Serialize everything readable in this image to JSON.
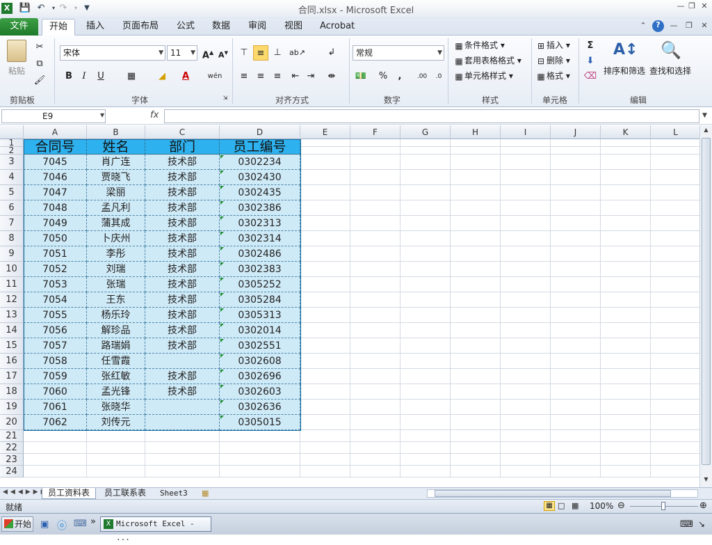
{
  "window": {
    "title": "合同.xlsx - Microsoft Excel"
  },
  "tabs": [
    {
      "label": "文件"
    },
    {
      "label": "开始"
    },
    {
      "label": "插入"
    },
    {
      "label": "页面布局"
    },
    {
      "label": "公式"
    },
    {
      "label": "数据"
    },
    {
      "label": "审阅"
    },
    {
      "label": "视图"
    },
    {
      "label": "Acrobat"
    }
  ],
  "ribbon": {
    "clipboard": {
      "paste": "粘贴",
      "label": "剪贴板"
    },
    "font": {
      "name": "宋体",
      "size": "11",
      "label": "字体"
    },
    "align": {
      "label": "对齐方式"
    },
    "number": {
      "format": "常规",
      "label": "数字"
    },
    "styles": {
      "cond": "条件格式",
      "table": "套用表格格式",
      "cell": "单元格样式",
      "label": "样式"
    },
    "cells": {
      "insert": "插入",
      "delete": "删除",
      "format": "格式",
      "label": "单元格"
    },
    "edit": {
      "sort": "排序和筛选",
      "find": "查找和选择",
      "label": "编辑"
    }
  },
  "namebox": "E9",
  "fx": "fx",
  "columns": [
    "A",
    "B",
    "C",
    "D",
    "E",
    "F",
    "G",
    "H",
    "I",
    "J",
    "K",
    "L"
  ],
  "table": {
    "headers": [
      "合同号",
      "姓名",
      "部门",
      "员工编号"
    ],
    "rows": [
      [
        "7045",
        "肖广连",
        "技术部",
        "0302234"
      ],
      [
        "7046",
        "贾晓飞",
        "技术部",
        "0302430"
      ],
      [
        "7047",
        "梁丽",
        "技术部",
        "0302435"
      ],
      [
        "7048",
        "孟凡利",
        "技术部",
        "0302386"
      ],
      [
        "7049",
        "蒲其成",
        "技术部",
        "0302313"
      ],
      [
        "7050",
        "卜庆州",
        "技术部",
        "0302314"
      ],
      [
        "7051",
        "李彤",
        "技术部",
        "0302486"
      ],
      [
        "7052",
        "刘瑞",
        "技术部",
        "0302383"
      ],
      [
        "7053",
        "张瑞",
        "技术部",
        "0305252"
      ],
      [
        "7054",
        "王东",
        "技术部",
        "0305284"
      ],
      [
        "7055",
        "杨乐玲",
        "技术部",
        "0305313"
      ],
      [
        "7056",
        "解珍品",
        "技术部",
        "0302014"
      ],
      [
        "7057",
        "路瑞娟",
        "技术部",
        "0302551"
      ],
      [
        "7058",
        "任雪霞",
        "",
        "0302608"
      ],
      [
        "7059",
        "张红敏",
        "技术部",
        "0302696"
      ],
      [
        "7060",
        "孟光锋",
        "技术部",
        "0302603"
      ],
      [
        "7061",
        "张晓华",
        "",
        "0302636"
      ],
      [
        "7062",
        "刘传元",
        "",
        "0305015"
      ]
    ]
  },
  "row_numbers": [
    "1",
    "2",
    "3",
    "4",
    "5",
    "6",
    "7",
    "8",
    "9",
    "10",
    "11",
    "12",
    "13",
    "14",
    "15",
    "16",
    "17",
    "18",
    "19",
    "20",
    "21",
    "22",
    "23",
    "24"
  ],
  "sheets": [
    "员工资料表",
    "员工联系表",
    "Sheet3"
  ],
  "status": {
    "ready": "就绪",
    "zoom": "100%"
  },
  "taskbar": {
    "start": "开始",
    "app": "Microsoft Excel - ..."
  }
}
